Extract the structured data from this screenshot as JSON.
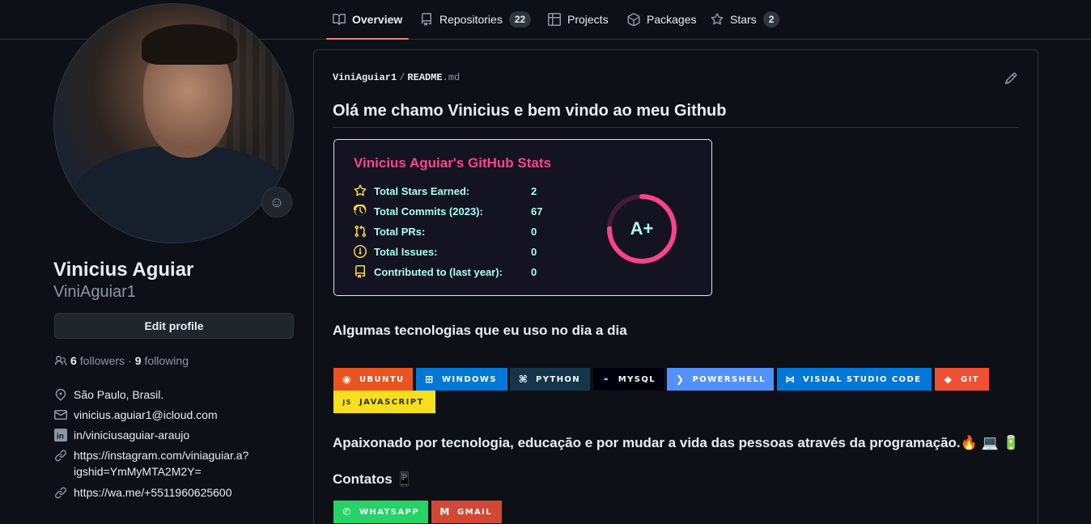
{
  "tabs": [
    {
      "label": "Overview",
      "icon": "book-icon",
      "active": true
    },
    {
      "label": "Repositories",
      "icon": "repo-icon",
      "count": "22"
    },
    {
      "label": "Projects",
      "icon": "project-icon"
    },
    {
      "label": "Packages",
      "icon": "package-icon"
    },
    {
      "label": "Stars",
      "icon": "star-icon",
      "count": "2"
    }
  ],
  "profile": {
    "name": "Vinicius Aguiar",
    "login": "ViniAguiar1",
    "edit_label": "Edit profile",
    "followers_count": "6",
    "followers_label": "followers",
    "dot": "·",
    "following_count": "9",
    "following_label": "following",
    "location": "São Paulo, Brasil.",
    "email": "vinicius.aguiar1@icloud.com",
    "linkedin": "in/viniciusaguiar-araujo",
    "instagram_line1": "https://instagram.com/viniaguiar.a?",
    "instagram_line2": "igshid=YmMyMTA2M2Y=",
    "whatsapp": "https://wa.me/+5511960625600"
  },
  "readme": {
    "owner": "ViniAguiar1",
    "sep": "/",
    "file": "README",
    "ext": ".md",
    "heading": "Olá me chamo Vinicius e bem vindo ao meu Github",
    "stats": {
      "title": "Vinicius Aguiar's GitHub Stats",
      "rows": [
        {
          "label": "Total Stars Earned:",
          "value": "2",
          "icon": "star-icon"
        },
        {
          "label": "Total Commits (2023):",
          "value": "67",
          "icon": "history-icon"
        },
        {
          "label": "Total PRs:",
          "value": "0",
          "icon": "pull-request-icon"
        },
        {
          "label": "Total Issues:",
          "value": "0",
          "icon": "issue-icon"
        },
        {
          "label": "Contributed to (last year):",
          "value": "0",
          "icon": "repo-icon"
        }
      ],
      "grade": "A+",
      "grade_progress": 0.75,
      "colors": {
        "title": "#fe428e",
        "text": "#a9fef7",
        "icon": "#f8d847",
        "bg": "#141321"
      }
    },
    "tech_heading": "Algumas tecnologias que eu uso no dia a dia",
    "badges": [
      {
        "label": "UBUNTU",
        "color": "#E95420",
        "icon": "ubuntu-icon"
      },
      {
        "label": "WINDOWS",
        "color": "#0078D6",
        "icon": "windows-icon"
      },
      {
        "label": "PYTHON",
        "color": "#14354C",
        "icon": "python-icon"
      },
      {
        "label": "MYSQL",
        "color": "#00000F",
        "icon": "mysql-icon"
      },
      {
        "label": "POWERSHELL",
        "color": "#5391FE",
        "icon": "powershell-icon"
      },
      {
        "label": "VISUAL STUDIO CODE",
        "color": "#0078d7",
        "icon": "vscode-icon"
      },
      {
        "label": "GIT",
        "color": "#F05033",
        "icon": "git-icon"
      },
      {
        "label": "JAVASCRIPT",
        "color": "#F7DF1E",
        "text_color": "#323330",
        "icon": "javascript-icon"
      }
    ],
    "about": "Apaixonado por tecnologia, educação e por mudar a vida das pessoas através da programação.",
    "about_emojis": [
      "🔥",
      "💻",
      "🔋"
    ],
    "contacts_heading": "Contatos",
    "contacts_emoji": "📱",
    "contact_badges": [
      {
        "label": "WHATSAPP",
        "color": "#25D366",
        "icon": "whatsapp-icon"
      },
      {
        "label": "GMAIL",
        "color": "#D14836",
        "icon": "gmail-icon"
      }
    ]
  }
}
